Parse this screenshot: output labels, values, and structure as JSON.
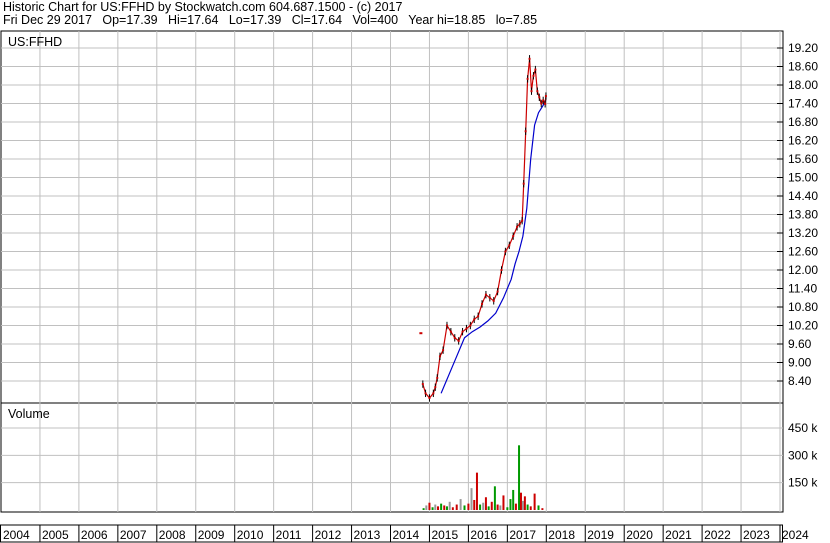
{
  "header": {
    "line1": "Historic Chart for US:FFHD by Stockwatch.com 604.687.1500 - (c) 2017",
    "line2": "Fri Dec 29 2017   Op=17.39   Hi=17.64   Lo=17.39   Cl=17.64   Vol=400   Year hi=18.85   lo=7.85"
  },
  "chart_data": [
    {
      "type": "line",
      "title": "US:FFHD",
      "ylim": [
        7.85,
        19.6
      ],
      "y_ticks": [
        "19.20",
        "18.60",
        "18.00",
        "17.40",
        "16.80",
        "16.20",
        "15.60",
        "15.00",
        "14.40",
        "13.80",
        "13.20",
        "12.60",
        "12.00",
        "11.40",
        "10.80",
        "10.20",
        "9.60",
        "9.00",
        "8.40"
      ],
      "x_ticks": [
        "2004",
        "2005",
        "2006",
        "2007",
        "2008",
        "2009",
        "2010",
        "2011",
        "2012",
        "2013",
        "2014",
        "2015",
        "2016",
        "2017",
        "2018",
        "2019",
        "2020",
        "2021",
        "2022",
        "2023",
        "2024"
      ],
      "grid": true,
      "colors": {
        "price": "#cc0000",
        "moving_average": "#0000cc",
        "bar": "#000000"
      },
      "series": [
        {
          "x": [
            2014.83,
            2014.9,
            2015.0,
            2015.1,
            2015.15,
            2015.2,
            2015.27,
            2015.35,
            2015.45,
            2015.55,
            2015.65,
            2015.75,
            2015.85,
            2015.95,
            2016.05,
            2016.15,
            2016.25,
            2016.35,
            2016.45,
            2016.55,
            2016.65,
            2016.75,
            2016.85,
            2016.95,
            2017.05,
            2017.15,
            2017.25,
            2017.32,
            2017.38,
            2017.42,
            2017.47,
            2017.52,
            2017.57,
            2017.62,
            2017.67,
            2017.72,
            2017.77,
            2017.82,
            2017.87,
            2017.92,
            2017.97,
            2017.99
          ],
          "values": [
            8.3,
            8.0,
            7.85,
            8.0,
            8.2,
            8.5,
            9.2,
            9.4,
            10.2,
            10.0,
            9.8,
            9.7,
            10.0,
            10.1,
            10.2,
            10.4,
            10.5,
            10.9,
            11.2,
            11.1,
            11.0,
            11.3,
            12.0,
            12.6,
            12.8,
            13.1,
            13.4,
            13.5,
            13.6,
            14.8,
            16.5,
            18.2,
            18.85,
            17.8,
            18.3,
            18.5,
            17.8,
            17.6,
            17.4,
            17.5,
            17.39,
            17.64
          ]
        },
        {
          "x": [
            2015.3,
            2015.5,
            2015.7,
            2015.9,
            2016.1,
            2016.3,
            2016.5,
            2016.7,
            2016.9,
            2017.1,
            2017.2,
            2017.3,
            2017.4,
            2017.5,
            2017.6,
            2017.7,
            2017.8,
            2017.9,
            2017.99
          ],
          "values": [
            8.0,
            8.6,
            9.2,
            9.8,
            10.0,
            10.15,
            10.35,
            10.6,
            11.1,
            11.7,
            12.2,
            12.6,
            13.1,
            14.0,
            15.6,
            16.7,
            17.1,
            17.3,
            17.5
          ]
        }
      ],
      "outliers": [
        {
          "x": 2014.78,
          "y": 9.95
        }
      ]
    },
    {
      "type": "bar",
      "title": "Volume",
      "ylim": [
        0,
        520
      ],
      "y_ticks": [
        "450 k",
        "300 k",
        "150 k"
      ],
      "colors": {
        "up": "#cc0000",
        "down": "#009900",
        "flat": "#999999"
      },
      "x": [
        2014.85,
        2014.92,
        2015.0,
        2015.08,
        2015.15,
        2015.22,
        2015.3,
        2015.38,
        2015.45,
        2015.52,
        2015.6,
        2015.7,
        2015.8,
        2015.9,
        2016.0,
        2016.08,
        2016.15,
        2016.22,
        2016.3,
        2016.38,
        2016.45,
        2016.52,
        2016.6,
        2016.68,
        2016.75,
        2016.82,
        2016.9,
        2017.0,
        2017.08,
        2017.15,
        2017.22,
        2017.3,
        2017.35,
        2017.4,
        2017.45,
        2017.52,
        2017.6,
        2017.7,
        2017.8,
        2017.9
      ],
      "values": [
        10,
        25,
        40,
        15,
        30,
        20,
        35,
        25,
        20,
        45,
        15,
        30,
        60,
        25,
        35,
        120,
        55,
        205,
        30,
        40,
        70,
        20,
        45,
        130,
        30,
        25,
        80,
        15,
        60,
        110,
        35,
        355,
        95,
        50,
        75,
        30,
        20,
        90,
        25,
        10
      ],
      "bar_colors": [
        "down",
        "flat",
        "up",
        "down",
        "flat",
        "up",
        "down",
        "up",
        "down",
        "flat",
        "up",
        "up",
        "flat",
        "down",
        "up",
        "flat",
        "up",
        "up",
        "down",
        "flat",
        "up",
        "down",
        "up",
        "down",
        "up",
        "flat",
        "up",
        "down",
        "down",
        "down",
        "up",
        "down",
        "up",
        "flat",
        "up",
        "down",
        "up",
        "up",
        "down",
        "up"
      ]
    }
  ]
}
